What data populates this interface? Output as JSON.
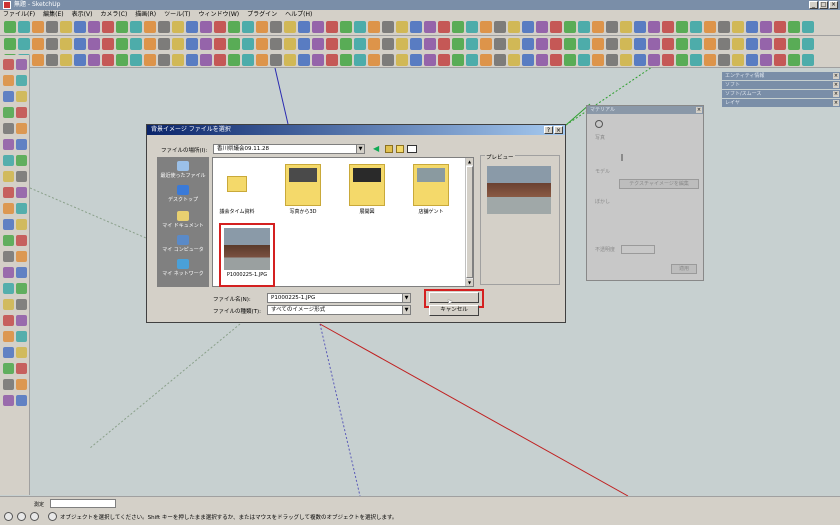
{
  "window": {
    "title": "無題 - SketchUp",
    "minimize_glyph": "_",
    "maximize_glyph": "□",
    "close_glyph": "×"
  },
  "menubar": [
    "ファイル(F)",
    "編集(E)",
    "表示(V)",
    "カメラ(C)",
    "描画(R)",
    "ツール(T)",
    "ウィンドウ(W)",
    "プラグイン",
    "ヘルプ(H)"
  ],
  "right_panels": [
    "エンティティ情報",
    "ソフト",
    "ソフト/スムース",
    "レイヤ"
  ],
  "materials_panel": {
    "title": "マテリアル",
    "row1": "写真",
    "row2": "モデル",
    "btn1": "テクスチャイメージを編集",
    "row3": "ぼかし",
    "row4": "不透明度",
    "btn2": "適用",
    "close_glyph": "×"
  },
  "dialog": {
    "title": "背景イメージ ファイルを選択",
    "help_glyph": "?",
    "close_glyph": "×",
    "location_label": "ファイルの場所(I):",
    "location_value": "香川県議会09.11.28",
    "places": [
      "最近使ったファイル",
      "デスクトップ",
      "マイ ドキュメント",
      "マイ コンピュータ",
      "マイ ネットワーク"
    ],
    "folders": [
      "議会タイム資料",
      "写真から3D",
      "展開図",
      "店舗ゲント"
    ],
    "selected_file": "P1000225-1.JPG",
    "preview_label": "プレビュー",
    "filename_label": "ファイル名(N):",
    "filename_value": "P1000225-1.JPG",
    "filetype_label": "ファイルの種類(T):",
    "filetype_value": "すべてのイメージ形式",
    "open_button": "",
    "cancel_button": "キャンセル",
    "dropdown_glyph": "▼",
    "scroll_up_glyph": "▲",
    "scroll_down_glyph": "▼"
  },
  "statusbar": {
    "measure_label": "測定",
    "message": "オブジェクトを選択してください。Shift キーを押したまま選択するか、またはマウスをドラッグして複数のオブジェクトを選択します。"
  },
  "colors": {
    "viewport": "#c7d0d0",
    "chrome": "#d4d0c8",
    "title": "#7a8ea8",
    "dialog_title": "#0a246a",
    "highlight": "#d42020"
  }
}
